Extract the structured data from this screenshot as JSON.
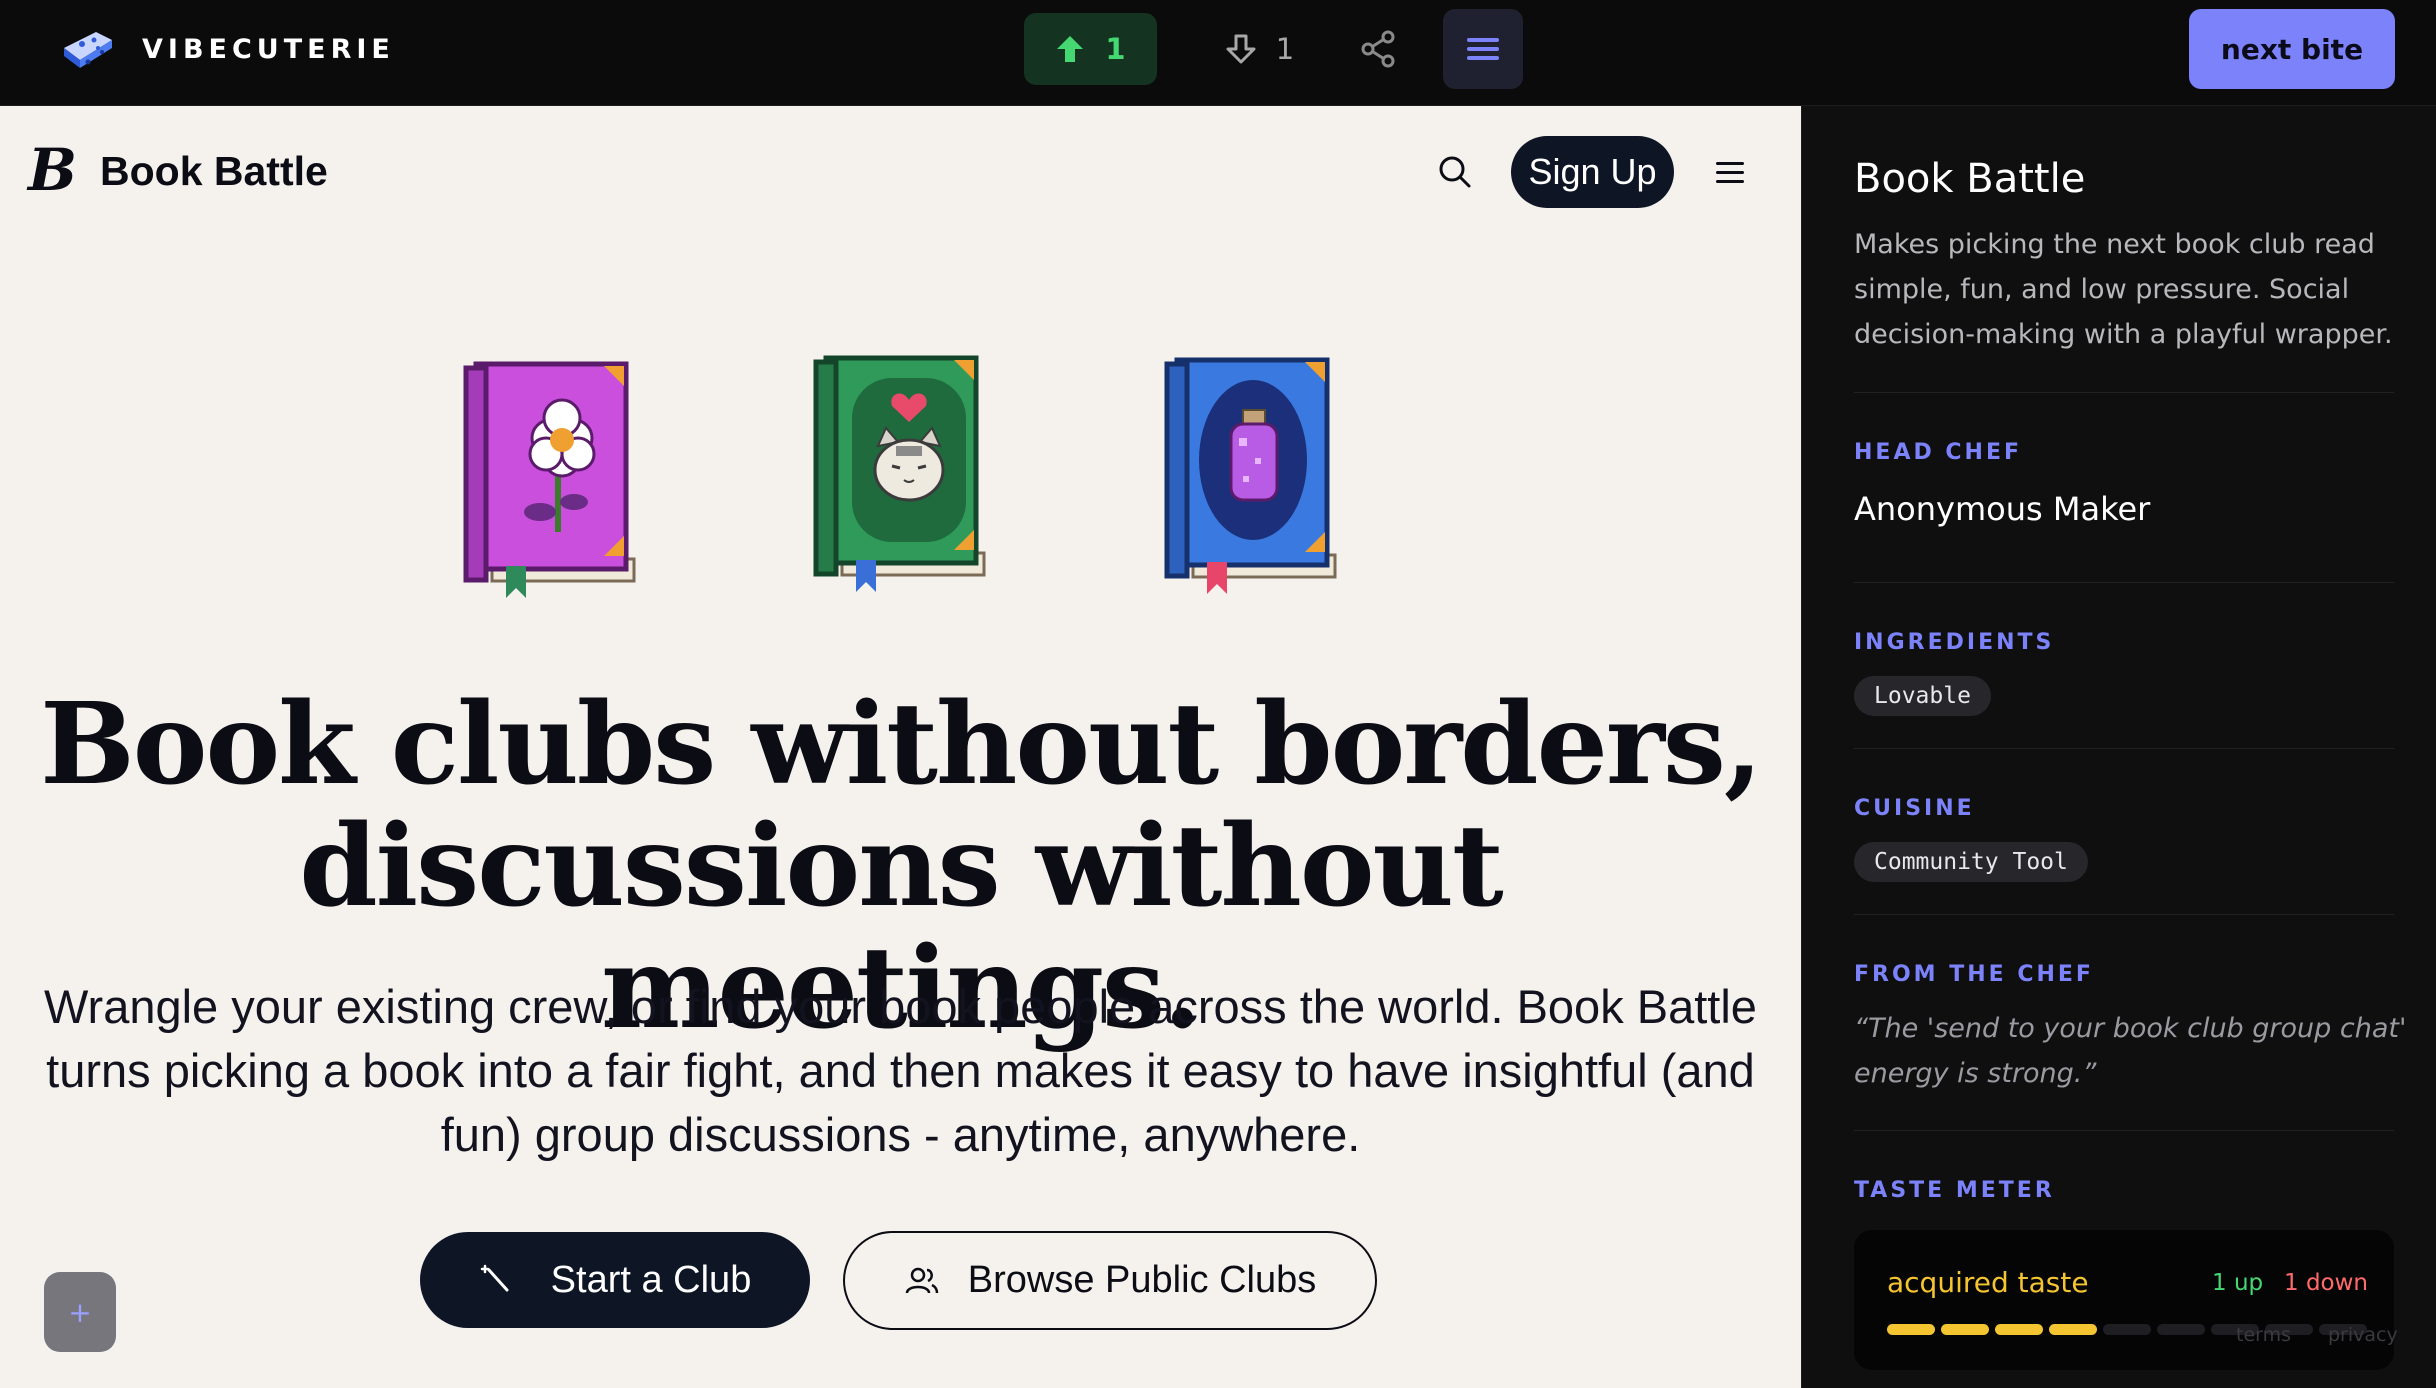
{
  "topbar": {
    "brand": "VIBECUTERIE",
    "upvotes": "1",
    "downvotes": "1",
    "next_label": "next bite"
  },
  "site": {
    "logo_letter": "B",
    "name": "Book Battle",
    "signup_label": "Sign Up",
    "hero_title_line1": "Book clubs without borders,",
    "hero_title_line2": "discussions without meetings.",
    "hero_sub": "Wrangle your existing crew, or find your book people across the world. Book Battle turns picking a book into a fair fight, and then makes it easy to have insightful (and fun) group discussions - anytime, anywhere.",
    "start_label": "Start a Club",
    "browse_label": "Browse Public Clubs",
    "fab_label": "+"
  },
  "panel": {
    "title": "Book Battle",
    "description": "Makes picking the next book club read simple, fun, and low pressure. Social decision-making with a playful wrapper.",
    "head_chef_label": "HEAD CHEF",
    "head_chef": "Anonymous Maker",
    "ingredients_label": "INGREDIENTS",
    "ingredients": [
      "Lovable"
    ],
    "cuisine_label": "CUISINE",
    "cuisine": [
      "Community Tool"
    ],
    "from_chef_label": "FROM THE CHEF",
    "quote": "“The 'send to your book club group chat' energy is strong.”",
    "taste_label": "TASTE METER",
    "taste_word": "acquired taste",
    "taste_up": "1 up",
    "taste_down": "1 down",
    "taste_level": 4,
    "taste_total": 9,
    "footer": {
      "terms": "terms",
      "privacy": "privacy"
    }
  },
  "colors": {
    "accent": "#7c83fa",
    "up_green": "#45d872",
    "down_red": "#ff6b6b",
    "taste_yellow": "#f5c431",
    "ink": "#0e1525",
    "paper": "#f5f2ee"
  },
  "icons": [
    "cheese-icon",
    "arrow-up-icon",
    "arrow-down-icon",
    "share-icon",
    "menu-icon",
    "search-icon",
    "hamburger-icon",
    "wand-icon",
    "users-icon",
    "plus-icon"
  ]
}
